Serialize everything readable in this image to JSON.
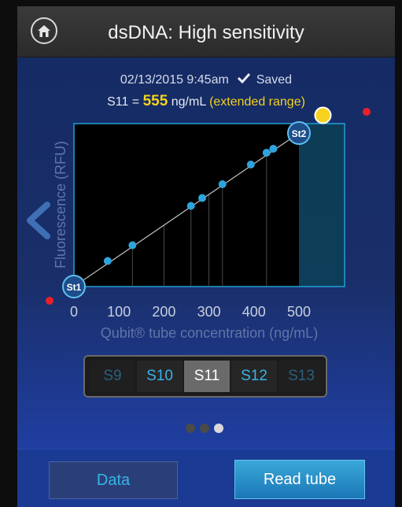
{
  "header": {
    "title": "dsDNA: High sensitivity",
    "home_icon": "home-icon"
  },
  "reading": {
    "datetime": "02/13/2015 9:45am",
    "saved_label": "Saved",
    "sample_prefix": "S11 = ",
    "value": "555",
    "unit": " ng/mL ",
    "range_note": "(extended range)"
  },
  "chart_data": {
    "type": "scatter",
    "xlabel": "Qubit® tube concentration (ng/mL)",
    "ylabel": "Fluorescence (RFU)",
    "xlim": [
      0,
      600
    ],
    "xticks": [
      "0",
      "100",
      "200",
      "300",
      "400",
      "500"
    ],
    "tick_values": [
      0,
      100,
      200,
      300,
      400,
      500
    ],
    "highlight_range": [
      500,
      600
    ],
    "points": [
      {
        "x": 75,
        "y": 0.13
      },
      {
        "x": 130,
        "y": 0.21
      },
      {
        "x": 260,
        "y": 0.41
      },
      {
        "x": 285,
        "y": 0.45
      },
      {
        "x": 330,
        "y": 0.52
      },
      {
        "x": 393,
        "y": 0.62
      },
      {
        "x": 428,
        "y": 0.68
      },
      {
        "x": 443,
        "y": 0.7
      }
    ],
    "standards": [
      {
        "label": "St1",
        "x": 0,
        "y": 0
      },
      {
        "label": "St2",
        "x": 500,
        "y": 0.78
      }
    ],
    "sample_point": {
      "x": 555,
      "y": 0.87
    },
    "colors": {
      "point": "#2ea4dc",
      "sample": "#f5d21d",
      "marker": "#e8202a"
    }
  },
  "samples": {
    "items": [
      "S9",
      "S10",
      "S11",
      "S12",
      "S13"
    ],
    "selected": "S11"
  },
  "pager": {
    "count": 3,
    "active": 2
  },
  "buttons": {
    "data": "Data",
    "read": "Read tube"
  },
  "nav": {
    "back_icon": "chevron-left-icon"
  }
}
